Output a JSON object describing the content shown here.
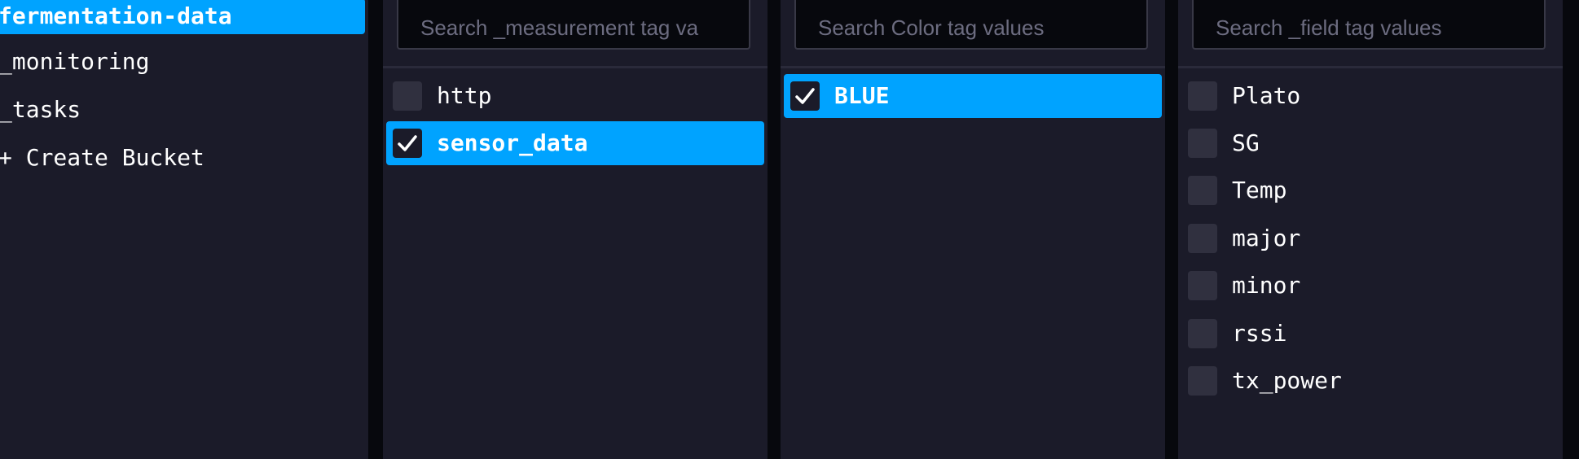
{
  "buckets": {
    "items": [
      {
        "label": "fermentation-data",
        "selected": true
      },
      {
        "label": "_monitoring",
        "selected": false
      },
      {
        "label": "_tasks",
        "selected": false
      },
      {
        "label": "+ Create Bucket",
        "selected": false
      }
    ]
  },
  "measurement_column": {
    "search_placeholder": "Search _measurement tag va",
    "items": [
      {
        "label": "http",
        "checked": false
      },
      {
        "label": "sensor_data",
        "checked": true
      }
    ]
  },
  "color_column": {
    "search_placeholder": "Search Color tag values",
    "items": [
      {
        "label": "BLUE",
        "checked": true
      }
    ]
  },
  "field_column": {
    "search_placeholder": "Search _field tag values",
    "items": [
      {
        "label": "Plato",
        "checked": false
      },
      {
        "label": "SG",
        "checked": false
      },
      {
        "label": "Temp",
        "checked": false
      },
      {
        "label": "major",
        "checked": false
      },
      {
        "label": "minor",
        "checked": false
      },
      {
        "label": "rssi",
        "checked": false
      },
      {
        "label": "tx_power",
        "checked": false
      }
    ]
  },
  "colors": {
    "accent": "#00a3ff",
    "panel_bg": "#1b1b29",
    "page_bg": "#07080d",
    "checkbox_bg": "#30303f"
  },
  "icons": {
    "check": "check-icon"
  }
}
